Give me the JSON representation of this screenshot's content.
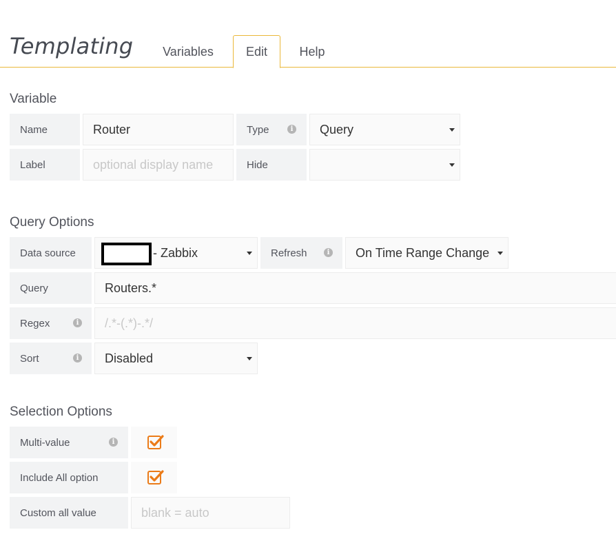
{
  "header": {
    "title": "Templating",
    "tabs": [
      {
        "label": "Variables",
        "active": false
      },
      {
        "label": "Edit",
        "active": true
      },
      {
        "label": "Help",
        "active": false
      }
    ]
  },
  "variable": {
    "heading": "Variable",
    "name_label": "Name",
    "name_value": "Router",
    "type_label": "Type",
    "type_value": "Query",
    "label_label": "Label",
    "label_placeholder": "optional display name",
    "hide_label": "Hide",
    "hide_value": ""
  },
  "query_options": {
    "heading": "Query Options",
    "datasource_label": "Data source",
    "datasource_value": "- Zabbix",
    "refresh_label": "Refresh",
    "refresh_value": "On Time Range Change",
    "query_label": "Query",
    "query_value": "Routers.*",
    "regex_label": "Regex",
    "regex_placeholder": "/.*-(.*)-.*/",
    "sort_label": "Sort",
    "sort_value": "Disabled"
  },
  "selection_options": {
    "heading": "Selection Options",
    "multi_value_label": "Multi-value",
    "multi_value_checked": true,
    "include_all_label": "Include All option",
    "include_all_checked": true,
    "custom_all_label": "Custom all value",
    "custom_all_placeholder": "blank = auto"
  },
  "colors": {
    "accent": "#eab839",
    "checkbox": "#eb7b18",
    "label_bg": "#f2f3f4"
  },
  "icons": [
    "info-icon",
    "caret-down-icon",
    "check-icon"
  ]
}
